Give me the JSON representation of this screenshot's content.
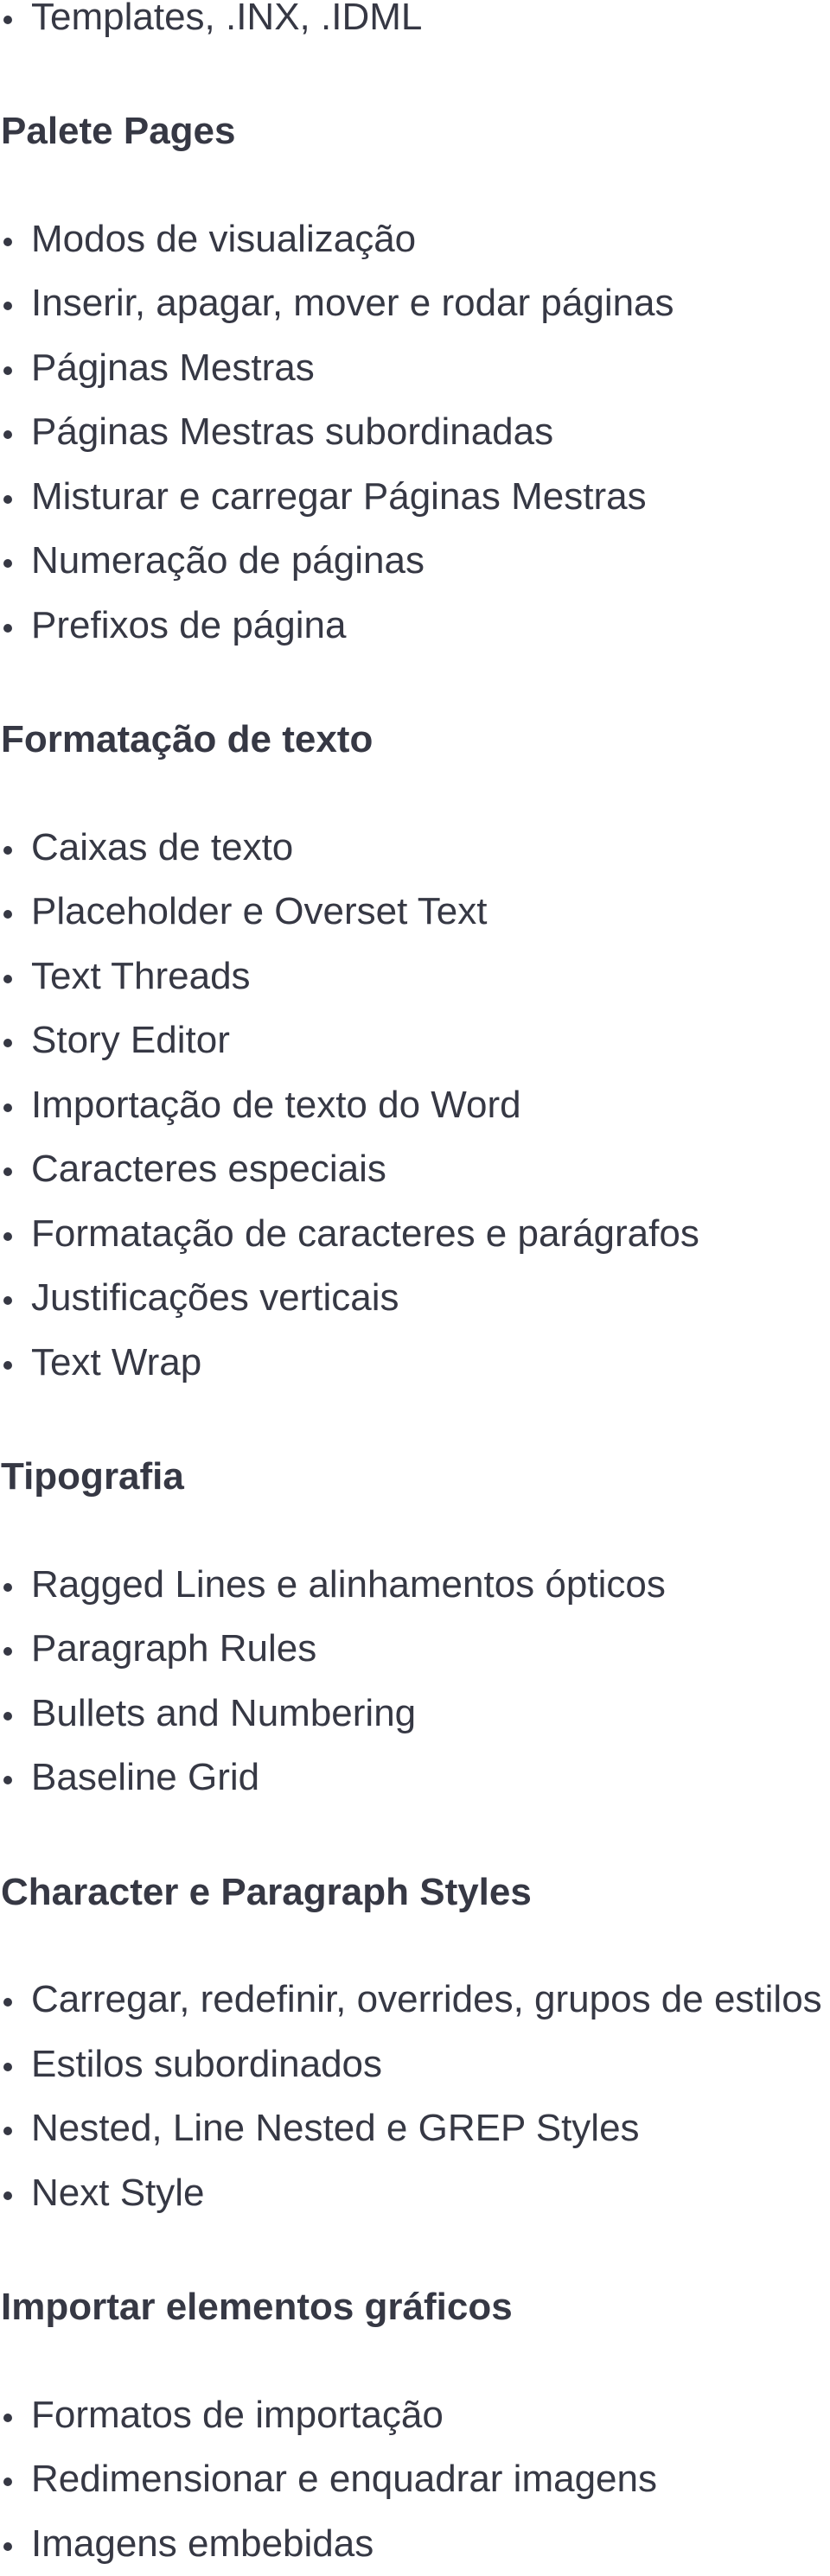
{
  "intro_items": [
    "Templates, .INX, .IDML"
  ],
  "sections": [
    {
      "heading": "Palete Pages",
      "items": [
        "Modos de visualização",
        "Inserir, apagar, mover e rodar páginas",
        "Págjnas Mestras",
        "Páginas Mestras subordinadas",
        "Misturar e carregar Páginas Mestras",
        "Numeração de páginas",
        "Prefixos de página"
      ]
    },
    {
      "heading": "Formatação de texto",
      "items": [
        "Caixas de texto",
        "Placeholder e Overset Text",
        "Text Threads",
        "Story Editor",
        "Importação de texto do Word",
        "Caracteres especiais",
        "Formatação de caracteres e parágrafos",
        "Justificações verticais",
        "Text Wrap"
      ]
    },
    {
      "heading": "Tipografia",
      "items": [
        "Ragged Lines e alinhamentos ópticos",
        "Paragraph Rules",
        "Bullets and Numbering",
        "Baseline Grid"
      ]
    },
    {
      "heading": "Character e Paragraph Styles",
      "items": [
        "Carregar, redefinir, overrides, grupos de estilos",
        "Estilos subordinados",
        "Nested, Line Nested e GREP Styles",
        "Next Style"
      ]
    },
    {
      "heading": "Importar elementos gráficos",
      "items": [
        "Formatos de importação",
        "Redimensionar e enquadrar imagens",
        "Imagens embebidas"
      ]
    }
  ],
  "colors": {
    "text": "#363844",
    "background": "#ffffff"
  }
}
